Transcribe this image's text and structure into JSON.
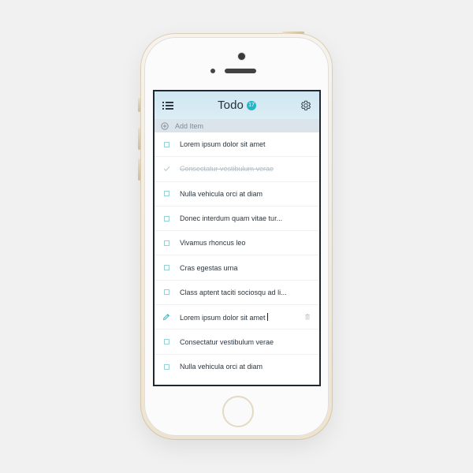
{
  "app": {
    "title": "Todo",
    "badge_count": "17",
    "accent_color": "#21b7c7"
  },
  "header": {
    "menu_icon": "list-icon",
    "settings_icon": "gear-icon"
  },
  "add_item": {
    "icon": "plus-circle-icon",
    "label": "Add Item"
  },
  "todos": [
    {
      "text": "Lorem ipsum dolor sit amet",
      "state": "unchecked"
    },
    {
      "text": "Consectatur vestibulum verae",
      "state": "completed"
    },
    {
      "text": "Nulla vehicula orci at diam",
      "state": "unchecked"
    },
    {
      "text": "Donec interdum quam vitae tur...",
      "state": "unchecked"
    },
    {
      "text": "Vivamus rhoncus leo",
      "state": "unchecked"
    },
    {
      "text": "Cras egestas urna",
      "state": "unchecked"
    },
    {
      "text": "Class aptent taciti sociosqu ad li...",
      "state": "unchecked"
    },
    {
      "text": "Lorem ipsum dolor sit amet",
      "state": "editing"
    },
    {
      "text": "Consectatur vestibulum verae",
      "state": "unchecked"
    },
    {
      "text": "Nulla vehicula orci at diam",
      "state": "unchecked"
    }
  ],
  "icons": {
    "checkbox": "checkbox-icon",
    "checkmark": "checkmark-icon",
    "edit": "pencil-icon",
    "delete": "trash-icon"
  }
}
